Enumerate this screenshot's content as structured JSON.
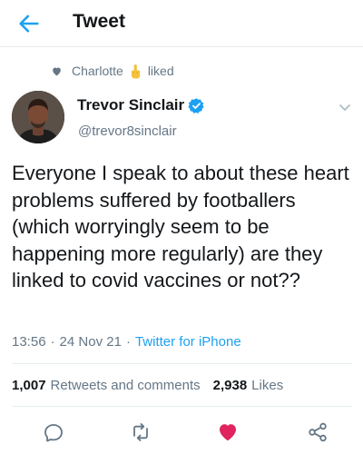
{
  "header": {
    "title": "Tweet",
    "back_icon": "arrow-left-icon",
    "accent_color": "#1da1f2"
  },
  "social_context": {
    "name": "Charlotte",
    "action": "liked",
    "icon": "heart-icon"
  },
  "author": {
    "display_name": "Trevor Sinclair",
    "handle": "@trevor8sinclair",
    "verified": true
  },
  "tweet": {
    "text": "Everyone I speak to about these heart problems suffered by footballers (which worryingly seem to be happening more regularly) are they linked to covid vaccines or not??",
    "time": "13:56",
    "date": "24 Nov 21",
    "source": "Twitter for iPhone"
  },
  "stats": {
    "retweets_count": "1,007",
    "retweets_label": "Retweets and comments",
    "likes_count": "2,938",
    "likes_label": "Likes"
  },
  "actions": {
    "reply_icon": "reply-icon",
    "retweet_icon": "retweet-icon",
    "like_icon": "heart-icon",
    "like_color": "#e0245e",
    "share_icon": "share-icon"
  }
}
